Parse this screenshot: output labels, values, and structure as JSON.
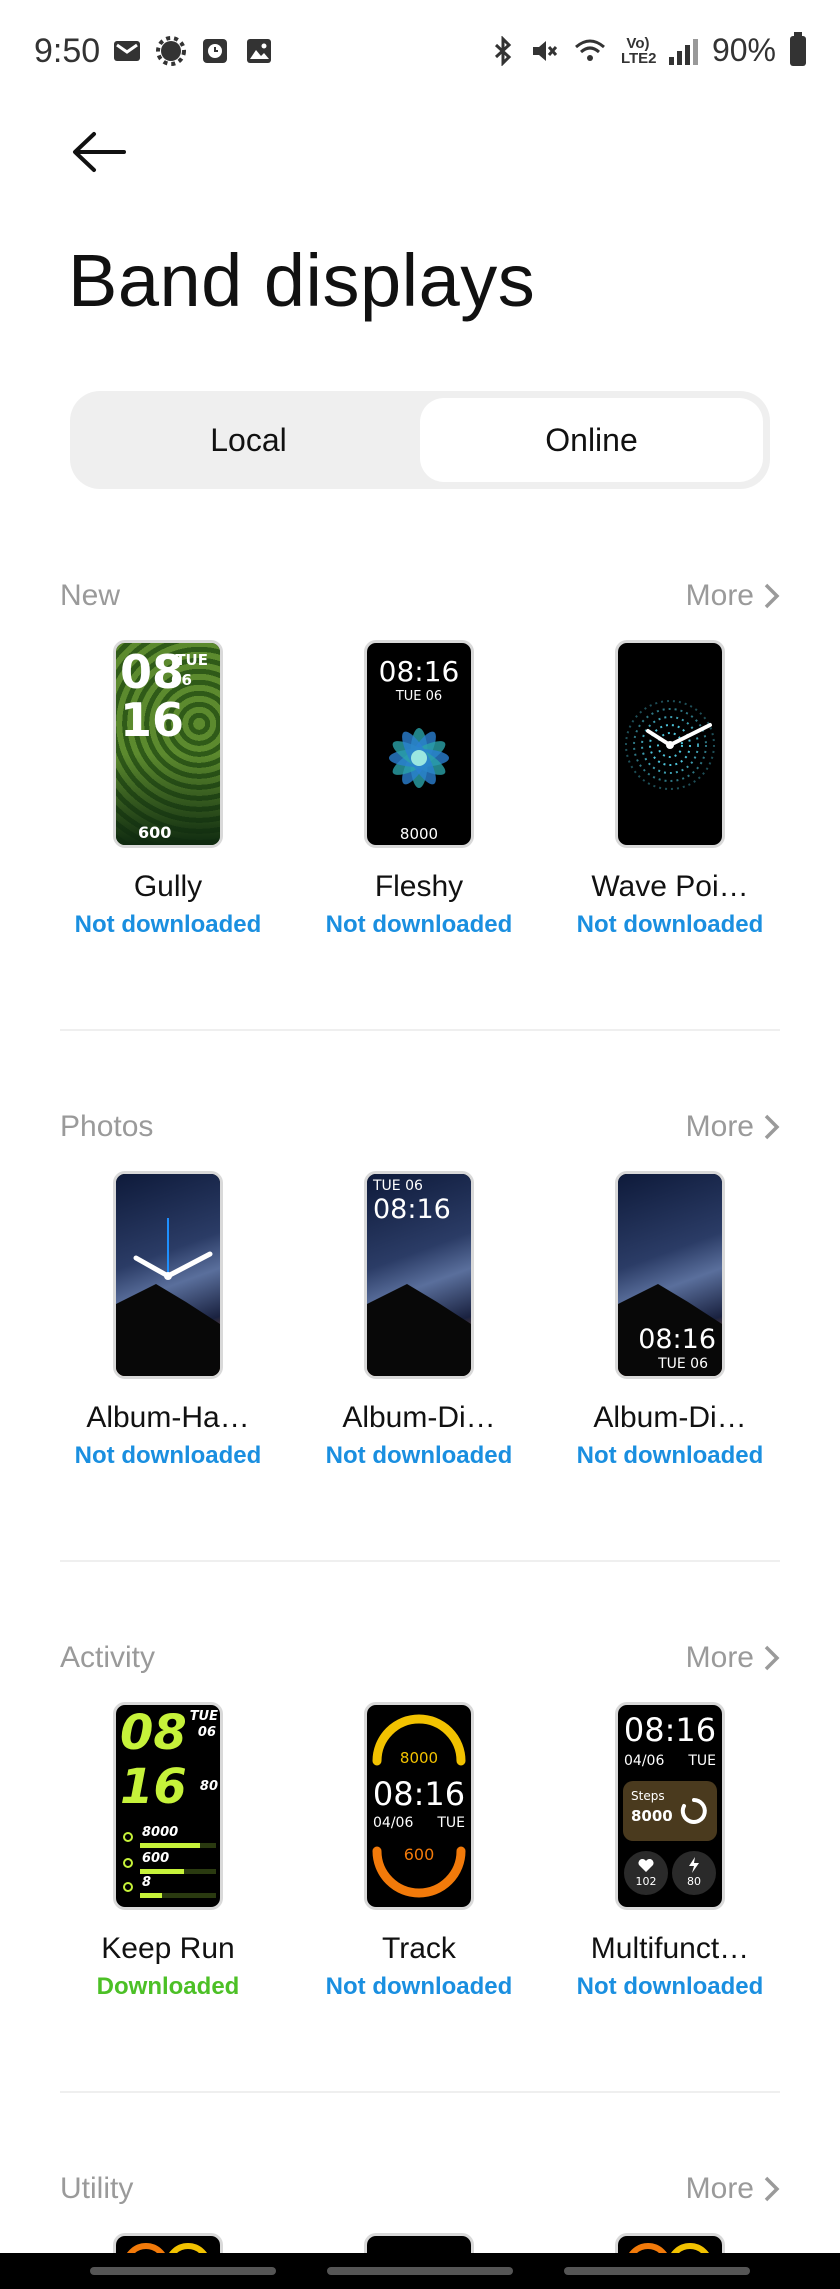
{
  "status_bar": {
    "time": "9:50",
    "battery_percent": "90%",
    "network_label": "Vo) LTE2",
    "icons_left": [
      "mail-icon",
      "gear-icon",
      "clock-icon",
      "image-icon"
    ],
    "icons_right": [
      "bluetooth-icon",
      "mute-icon",
      "wifi-icon",
      "signal-icon",
      "battery-icon"
    ]
  },
  "header": {
    "back_icon": "arrow-left-icon",
    "title": "Band displays"
  },
  "tabs": [
    {
      "label": "Local",
      "active": false
    },
    {
      "label": "Online",
      "active": true
    }
  ],
  "sections": [
    {
      "title": "New",
      "more_label": "More",
      "items": [
        {
          "name": "Gully",
          "status": "Not downloaded",
          "face": {
            "hour": "08",
            "minute": "16",
            "day": "TUE",
            "date": "06",
            "steps": "600"
          }
        },
        {
          "name": "Fleshy",
          "status": "Not downloaded",
          "face": {
            "time": "08:16",
            "date": "TUE 06",
            "steps": "8000"
          }
        },
        {
          "name": "Wave Poi…",
          "status": "Not downloaded",
          "face": {}
        }
      ]
    },
    {
      "title": "Photos",
      "more_label": "More",
      "items": [
        {
          "name": "Album-Ha…",
          "status": "Not downloaded",
          "face": {}
        },
        {
          "name": "Album-Di…",
          "status": "Not downloaded",
          "face": {
            "date": "TUE 06",
            "time": "08:16"
          }
        },
        {
          "name": "Album-Di…",
          "status": "Not downloaded",
          "face": {
            "time": "08:16",
            "date": "TUE 06"
          }
        }
      ]
    },
    {
      "title": "Activity",
      "more_label": "More",
      "items": [
        {
          "name": "Keep Run",
          "status": "Downloaded",
          "face": {
            "hour": "08",
            "minute": "16",
            "day": "TUE",
            "date": "06",
            "bpm": "80",
            "stat1": "8000",
            "stat2": "600",
            "stat3": "8"
          }
        },
        {
          "name": "Track",
          "status": "Not downloaded",
          "face": {
            "steps": "8000",
            "time": "08:16",
            "date": "04/06",
            "day": "TUE",
            "calories": "600"
          }
        },
        {
          "name": "Multifunct…",
          "status": "Not downloaded",
          "face": {
            "time": "08:16",
            "date": "04/06",
            "day": "TUE",
            "steps_label": "Steps",
            "steps": "8000",
            "heart": "102",
            "power": "80"
          }
        }
      ]
    },
    {
      "title": "Utility",
      "more_label": "More",
      "items": []
    }
  ],
  "colors": {
    "link_blue": "#1a8fe0",
    "downloaded_green": "#4cc026",
    "muted_gray": "#9a9a9a"
  }
}
